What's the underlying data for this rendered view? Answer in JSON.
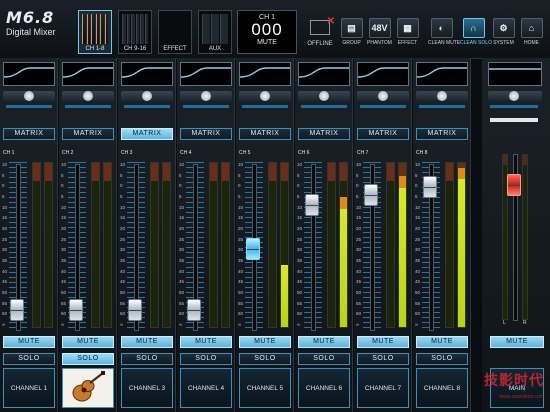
{
  "app": {
    "logo_model": "M6.8",
    "logo_sub": "Digital Mixer"
  },
  "overview_tabs": [
    {
      "label": "CH 1-8",
      "selected": true
    },
    {
      "label": "CH 9-16",
      "selected": false
    },
    {
      "label": "EFFECT",
      "selected": false
    },
    {
      "label": "AUX",
      "selected": false
    }
  ],
  "channel_display": {
    "label": "CH 1",
    "value": "000",
    "status": "MUTE"
  },
  "status": {
    "offline_label": "OFFLINE",
    "offline_icon": "computer-offline-icon"
  },
  "toolbar": [
    {
      "label": "GROUP",
      "icon": "group-icon",
      "glyph": "▤",
      "active": false
    },
    {
      "label": "PHANTOM",
      "icon": "phantom-48v-icon",
      "glyph": "48V",
      "active": false
    },
    {
      "label": "EFFECT",
      "icon": "effect-icon",
      "glyph": "▦",
      "active": false
    },
    {
      "label": "CLEAN MUTE",
      "icon": "clean-mute-icon",
      "glyph": "◐",
      "active": false
    },
    {
      "label": "CLEAN SOLO",
      "icon": "headphones-icon",
      "glyph": "∩",
      "active": true
    },
    {
      "label": "SYSTEM",
      "icon": "gear-icon",
      "glyph": "⚙",
      "active": false
    },
    {
      "label": "HOME",
      "icon": "home-icon",
      "glyph": "⌂",
      "active": false
    }
  ],
  "scale_labels": [
    "10",
    "5",
    "0",
    "5",
    "10",
    "15",
    "20",
    "25",
    "30",
    "35",
    "40",
    "45",
    "50",
    "55",
    "60",
    "∞"
  ],
  "channels": [
    {
      "ch": "CH 1",
      "name": "CHANNEL 1",
      "matrix": "MATRIX",
      "matrix_on": false,
      "mute": "MUTE",
      "solo": "SOLO",
      "solo_on": false,
      "fader_level": 0.05,
      "fader_lit": false,
      "meter_l": 0.0,
      "meter_r": 0.0
    },
    {
      "ch": "CH 2",
      "name": "",
      "matrix": "MATRIX",
      "matrix_on": false,
      "mute": "MUTE",
      "solo": "SOLO",
      "solo_on": true,
      "fader_level": 0.05,
      "fader_lit": false,
      "meter_l": 0.0,
      "meter_r": 0.0,
      "picture": "guitar-icon"
    },
    {
      "ch": "CH 3",
      "name": "CHANNEL 3",
      "matrix": "MATRIX",
      "matrix_on": true,
      "mute": "MUTE",
      "solo": "SOLO",
      "solo_on": false,
      "fader_level": 0.05,
      "fader_lit": false,
      "meter_l": 0.0,
      "meter_r": 0.0
    },
    {
      "ch": "CH 4",
      "name": "CHANNEL 4",
      "matrix": "MATRIX",
      "matrix_on": false,
      "mute": "MUTE",
      "solo": "SOLO",
      "solo_on": false,
      "fader_level": 0.05,
      "fader_lit": false,
      "meter_l": 0.0,
      "meter_r": 0.0
    },
    {
      "ch": "CH 5",
      "name": "CHANNEL 5",
      "matrix": "MATRIX",
      "matrix_on": false,
      "mute": "MUTE",
      "solo": "SOLO",
      "solo_on": false,
      "fader_level": 0.47,
      "fader_lit": true,
      "meter_l": 0.0,
      "meter_r": 0.38
    },
    {
      "ch": "CH 6",
      "name": "CHANNEL 6",
      "matrix": "MATRIX",
      "matrix_on": false,
      "mute": "MUTE",
      "solo": "SOLO",
      "solo_on": false,
      "fader_level": 0.78,
      "fader_lit": false,
      "meter_l": 0.0,
      "meter_r": 0.72,
      "peak_r": true
    },
    {
      "ch": "CH 7",
      "name": "CHANNEL 7",
      "matrix": "MATRIX",
      "matrix_on": false,
      "mute": "MUTE",
      "solo": "SOLO",
      "solo_on": false,
      "fader_level": 0.85,
      "fader_lit": false,
      "meter_l": 0.0,
      "meter_r": 0.85,
      "peak_r": true
    },
    {
      "ch": "CH 8",
      "name": "CHANNEL 8",
      "matrix": "MATRIX",
      "matrix_on": false,
      "mute": "MUTE",
      "solo": "SOLO",
      "solo_on": false,
      "fader_level": 0.9,
      "fader_lit": false,
      "meter_l": 0.0,
      "meter_r": 0.9,
      "peak_r": true
    }
  ],
  "main": {
    "mute": "MUTE",
    "name": "MAIN",
    "fader_level": 0.86,
    "left_label": "L",
    "right_label": "R",
    "meter_l": 0.0,
    "meter_r": 0.0
  },
  "watermark": {
    "text": "技影时代",
    "sub": "www.soundsoo.com"
  },
  "colors": {
    "accent": "#5db3dc",
    "meter": "#c8de18",
    "peak": "#e08a1a",
    "main_fader": "#e0352a"
  }
}
